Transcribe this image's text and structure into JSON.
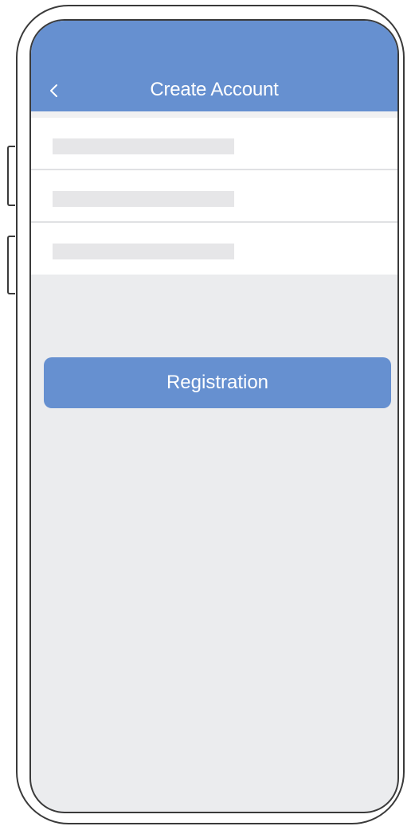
{
  "header": {
    "title": "Create Account",
    "back_icon": "chevron-left-icon"
  },
  "form": {
    "fields": [
      {
        "name": "field-1",
        "value": ""
      },
      {
        "name": "field-2",
        "value": ""
      },
      {
        "name": "field-3",
        "value": ""
      }
    ]
  },
  "actions": {
    "register_label": "Registration"
  },
  "colors": {
    "accent": "#6690d0",
    "background": "#ebecee",
    "placeholder": "#e6e6e8",
    "divider": "#e0e1e3"
  }
}
